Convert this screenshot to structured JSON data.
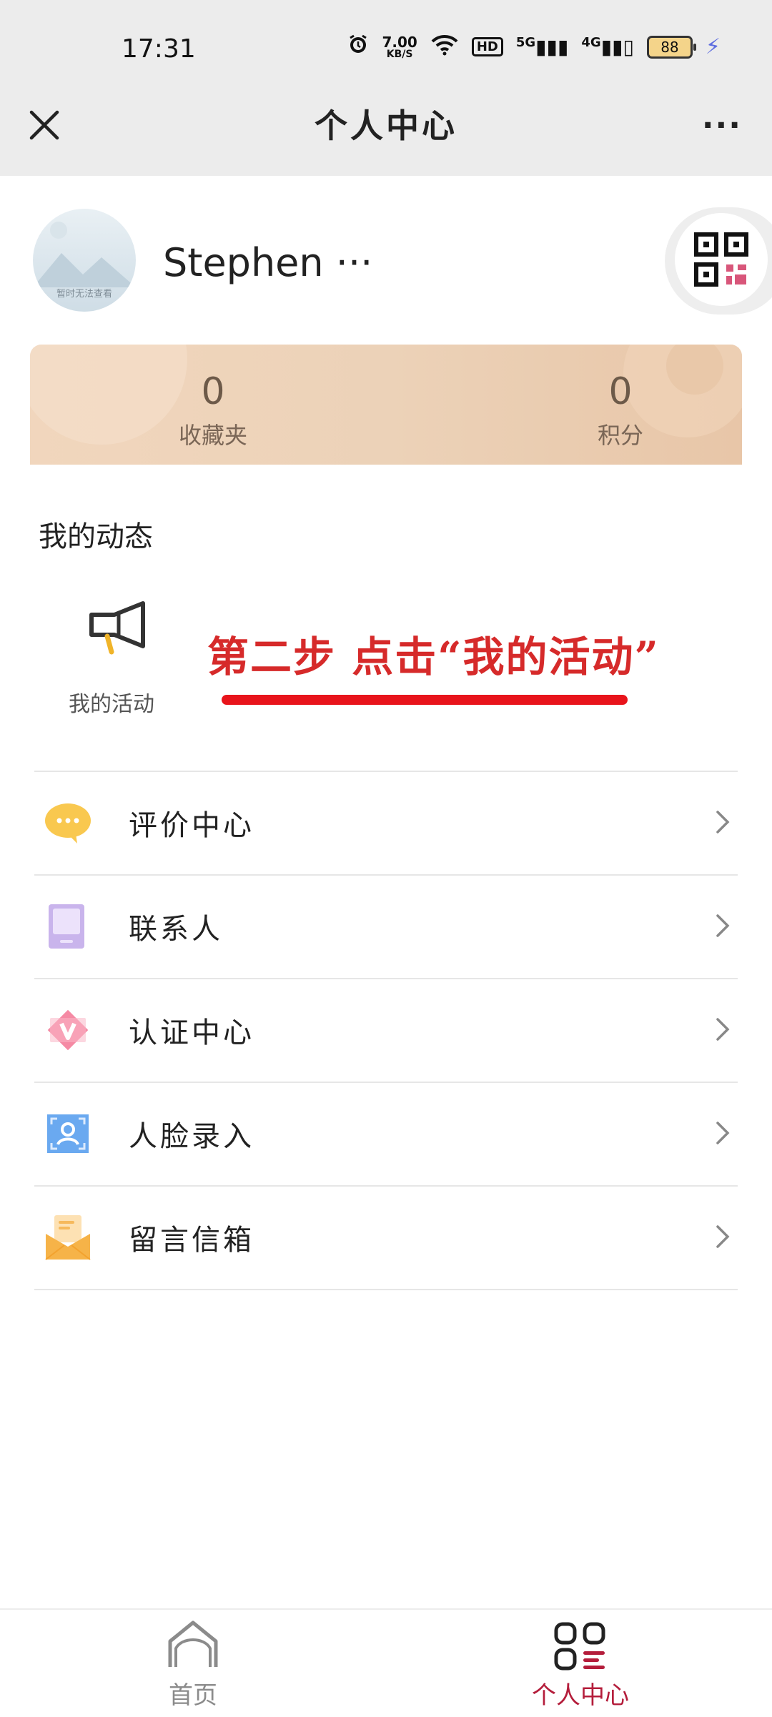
{
  "status_bar": {
    "time": "17:31",
    "net_speed_value": "7.00",
    "net_speed_unit": "KB/S",
    "hd_badge": "HD",
    "signal_5g": "5G",
    "signal_4g": "4G",
    "battery": "88"
  },
  "header": {
    "title": "个人中心",
    "more": "···"
  },
  "profile": {
    "avatar_text": "暂时无法查看",
    "username": "Stephen ···"
  },
  "stats": [
    {
      "value": "0",
      "label": "收藏夹"
    },
    {
      "value": "0",
      "label": "积分"
    }
  ],
  "activity": {
    "section_title": "我的动态",
    "item_label": "我的活动",
    "annotation": "第二步 点击“我的活动”"
  },
  "menu": [
    {
      "label": "评价中心",
      "icon": "chat-bubble-icon"
    },
    {
      "label": "联系人",
      "icon": "contacts-book-icon"
    },
    {
      "label": "认证中心",
      "icon": "verify-badge-icon"
    },
    {
      "label": "人脸录入",
      "icon": "face-id-icon"
    },
    {
      "label": "留言信箱",
      "icon": "mail-envelope-icon"
    }
  ],
  "bottom_nav": {
    "home": "首页",
    "me": "个人中心"
  },
  "colors": {
    "accent": "#b41d3b",
    "annotation": "#d62a2a",
    "card": "#ecd2b8"
  }
}
